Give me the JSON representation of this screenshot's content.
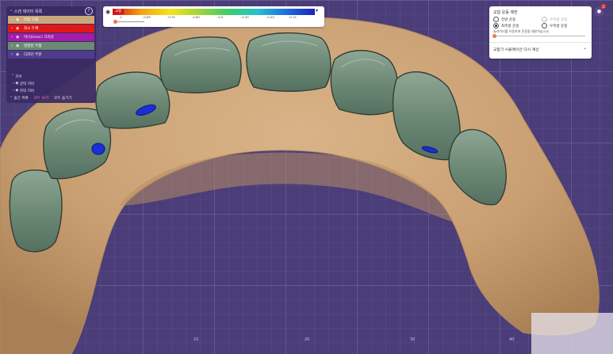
{
  "scan_panel": {
    "title": "스캔 데이터 목록",
    "help": "?",
    "items": [
      {
        "label": "작업 모델",
        "color": "#c9a87c"
      },
      {
        "label": "최소 두께",
        "color": "#e01818"
      },
      {
        "label": "이너(Inner) 크라운",
        "color": "#a11da6"
      },
      {
        "label": "병합된 부품",
        "color": "#6a8a72"
      },
      {
        "label": "디자인 부분",
        "color": "#4f3c8a"
      }
    ],
    "jaw_group": "치아",
    "jaw_items": [
      "상악 치아",
      "하악 치아"
    ],
    "footer_label": "숨긴 목록",
    "show_all": "모두 보기",
    "hide_all": "모두 숨기기"
  },
  "color_scale": {
    "badge": "교합",
    "ticks": [
      "-1",
      "-0.85",
      "-0.75",
      "-0.60",
      "-0.5",
      "-0.30",
      "-0.25",
      "-0.12"
    ],
    "chevron": "▾",
    "colors": [
      "#d41515",
      "#f3a314",
      "#f5e21a",
      "#9ed43a",
      "#3ccf66",
      "#27c1d3",
      "#1f6fe0",
      "#1d22b5"
    ]
  },
  "movement_panel": {
    "title": "교합 운동 제한",
    "options": [
      {
        "label": "전방 운동",
        "checked": false,
        "disabled": false
      },
      {
        "label": "우측방 운동",
        "checked": false,
        "disabled": true
      },
      {
        "label": "좌측방 운동",
        "checked": true,
        "disabled": false
      },
      {
        "label": "우측방 운동",
        "checked": false,
        "disabled": false
      }
    ],
    "slider_label": "슬라이더를 이동하여 운동을 제한하십시오.",
    "recalc_label": "교합기 시뮬레이션 다시 계산",
    "chevron": "⌄"
  },
  "axis_ticks": [
    "10",
    "20",
    "30",
    "40"
  ],
  "notification_count": "1",
  "icons": {
    "user": "user-icon",
    "eye": "eye-icon",
    "chevron": "chevron-right-icon"
  }
}
